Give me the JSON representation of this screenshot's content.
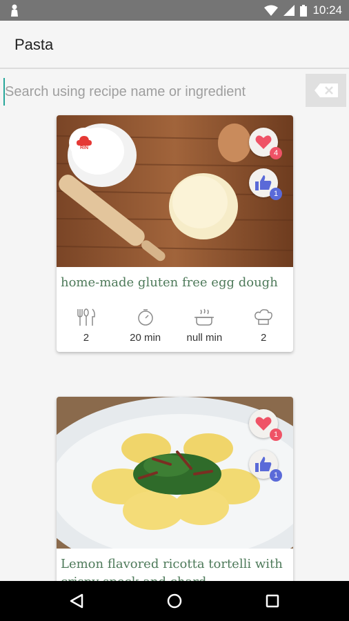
{
  "status": {
    "time": "10:24"
  },
  "appbar": {
    "title": "Pasta"
  },
  "search": {
    "placeholder": "Search using recipe name or ingredient"
  },
  "recipes": [
    {
      "title": "home-made gluten free egg dough",
      "likes": "4",
      "thumbs": "1",
      "stats": {
        "servings": "2",
        "prep_time": "20 min",
        "cook_time": "null min",
        "difficulty": "2"
      },
      "logo_text": "RIN"
    },
    {
      "title": "Lemon flavored ricotta tortelli with crispy speck and chard",
      "likes": "1",
      "thumbs": "1"
    }
  ],
  "colors": {
    "accent": "#26a69a",
    "title_green": "#4e7a5a",
    "heart": "#ef5366",
    "thumb": "#5a6ad8"
  },
  "icons": [
    "person-icon",
    "wifi-icon",
    "signal-icon",
    "battery-icon",
    "backspace-icon",
    "cutlery-icon",
    "timer-icon",
    "cooking-pot-icon",
    "chef-hat-icon",
    "heart-icon",
    "thumbs-up-icon",
    "back-nav-icon",
    "home-nav-icon",
    "recents-nav-icon"
  ]
}
